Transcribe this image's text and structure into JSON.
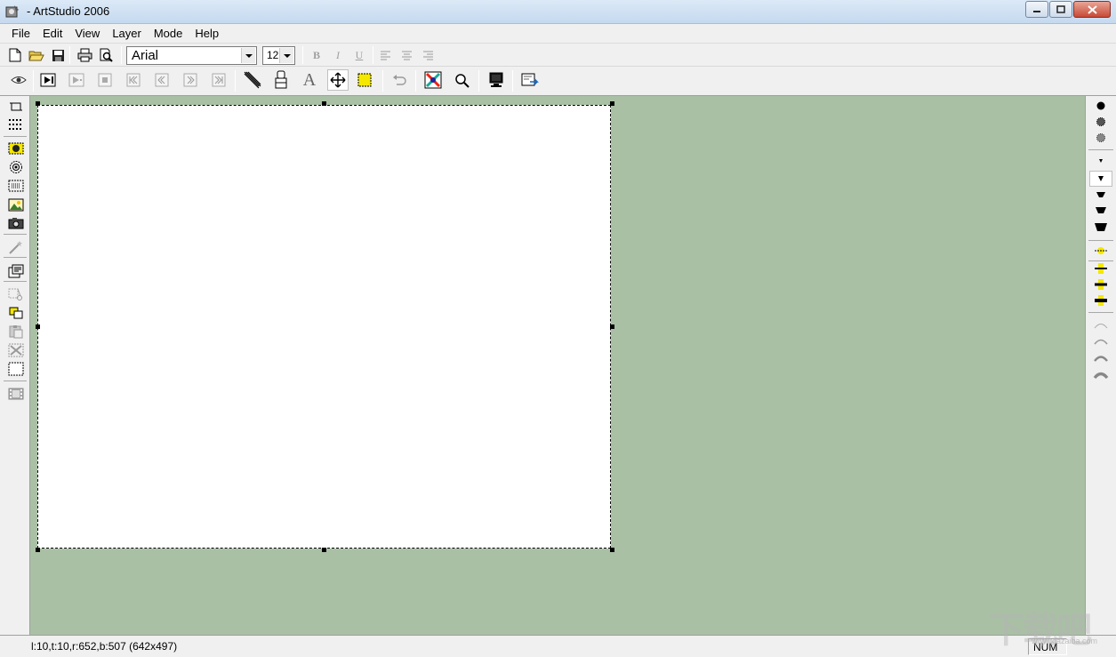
{
  "window": {
    "title": "- ArtStudio 2006",
    "icons": [
      "app-icon",
      "minimize-icon",
      "maximize-icon",
      "close-icon"
    ]
  },
  "menu": {
    "items": [
      {
        "label": "File"
      },
      {
        "label": "Edit"
      },
      {
        "label": "View"
      },
      {
        "label": "Layer"
      },
      {
        "label": "Mode"
      },
      {
        "label": "Help"
      }
    ]
  },
  "toolbar1": {
    "icons": [
      "new-file-icon",
      "open-folder-icon",
      "save-disk-icon",
      "print-icon",
      "print-preview-icon"
    ],
    "font_name": "Arial",
    "font_size": "12",
    "bold": "B",
    "italic": "I",
    "underline": "U",
    "align_icons": [
      "align-left-icon",
      "align-center-icon",
      "align-right-icon"
    ]
  },
  "toolbar2": {
    "icons": [
      "eye-icon",
      "play-frame-icon",
      "play-icon",
      "stop-icon",
      "first-frame-icon",
      "previous-frame-icon",
      "next-frame-icon",
      "last-frame-icon",
      "brush-tool-icon",
      "stamp-tool-icon",
      "text-tool-icon",
      "move-tool-icon",
      "selection-tool-icon",
      "undo-icon",
      "color-picker-icon",
      "zoom-icon",
      "monitor-icon",
      "export-icon"
    ],
    "text_tool_glyph": "A"
  },
  "left_toolbar": {
    "icons": [
      "crop-icon",
      "grid-icon",
      "ellipse-select-icon",
      "circle-select-icon",
      "marquee-select-icon",
      "image-icon",
      "camera-icon",
      "magic-wand-icon",
      "properties-icon",
      "cut-icon",
      "copy-icon",
      "paste-icon",
      "delete-icon",
      "select-all-icon",
      "filmstrip-icon"
    ]
  },
  "right_toolbar": {
    "groups": [
      "brush-shape",
      "brush-size",
      "line-thickness",
      "curve-style"
    ]
  },
  "status": {
    "coords": "l:10,t:10,r:652,b:507 (642x497)",
    "num": "NUM"
  },
  "watermark": {
    "text": "下载吧",
    "sub": "www.xiazaiba.com"
  },
  "colors": {
    "workspace": "#a9c0a5",
    "canvas": "#ffffff",
    "chrome": "#f0f0f0"
  }
}
